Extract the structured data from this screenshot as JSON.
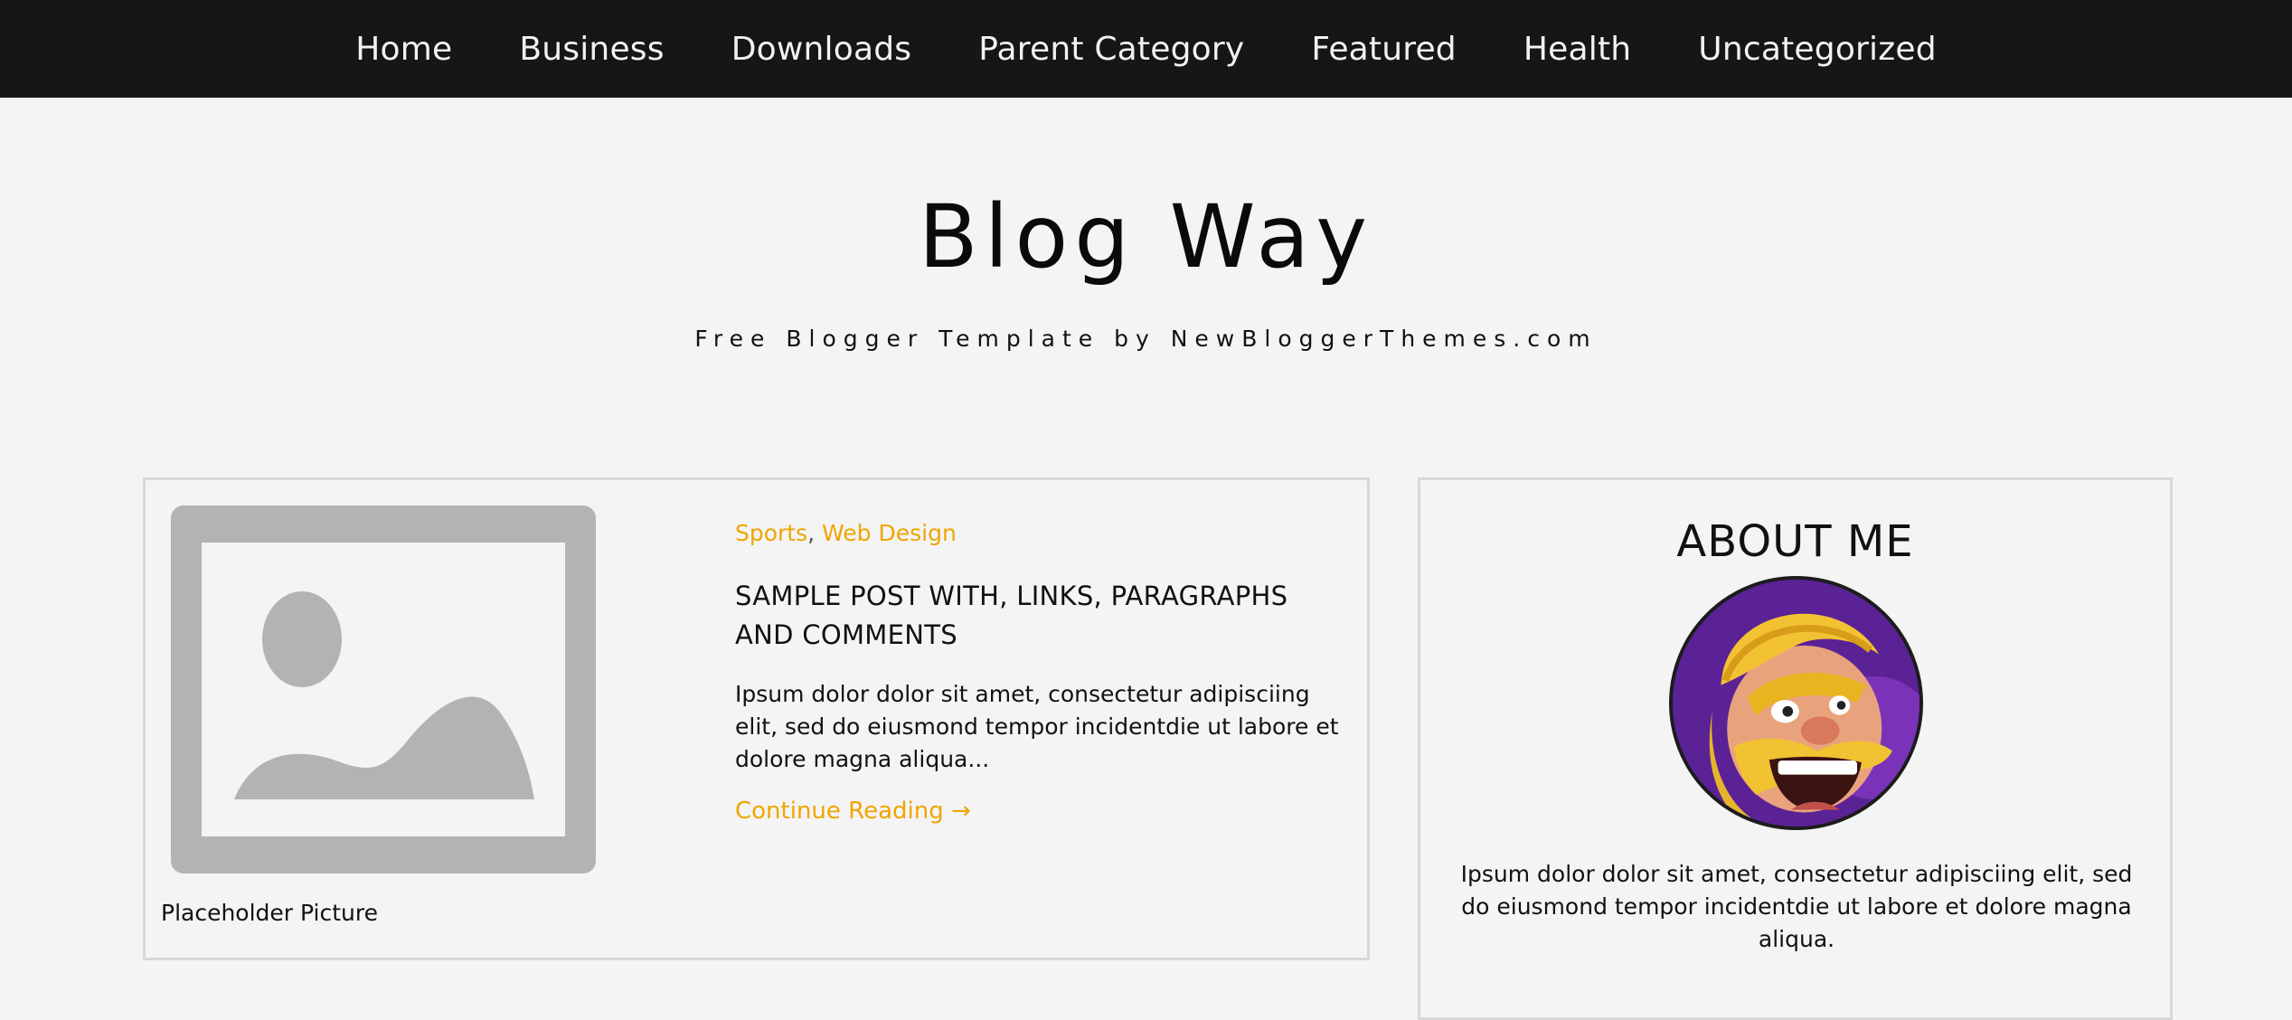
{
  "nav": {
    "items": [
      {
        "label": "Home"
      },
      {
        "label": "Business"
      },
      {
        "label": "Downloads"
      },
      {
        "label": "Parent Category"
      },
      {
        "label": "Featured"
      },
      {
        "label": "Health"
      },
      {
        "label": "Uncategorized"
      }
    ]
  },
  "header": {
    "title": "Blog Way",
    "description": "Free Blogger Template by NewBloggerThemes.com"
  },
  "post": {
    "thumbnail_caption": "Placeholder Picture",
    "thumbnail_icon": "image-placeholder-icon",
    "categories": [
      "Sports",
      "Web Design"
    ],
    "category_separator": ",",
    "title": "SAMPLE POST WITH, LINKS, PARAGRAPHS AND COMMENTS",
    "excerpt": "Ipsum dolor dolor sit amet, consectetur adipisciing elit, sed do eiusmond tempor incidentdie ut labore et dolore magna aliqua...",
    "read_more": "Continue Reading →"
  },
  "sidebar": {
    "about_title": "ABOUT ME",
    "about_text": "Ipsum dolor dolor sit amet, consectetur adipisciing elit, sed do eiusmond tempor incidentdie ut labore et dolore magna aliqua."
  },
  "colors": {
    "nav_bg": "#161616",
    "page_bg": "#f4f4f4",
    "accent": "#f0a500",
    "border": "#d8d8d8",
    "placeholder_gray": "#b3b3b3"
  }
}
